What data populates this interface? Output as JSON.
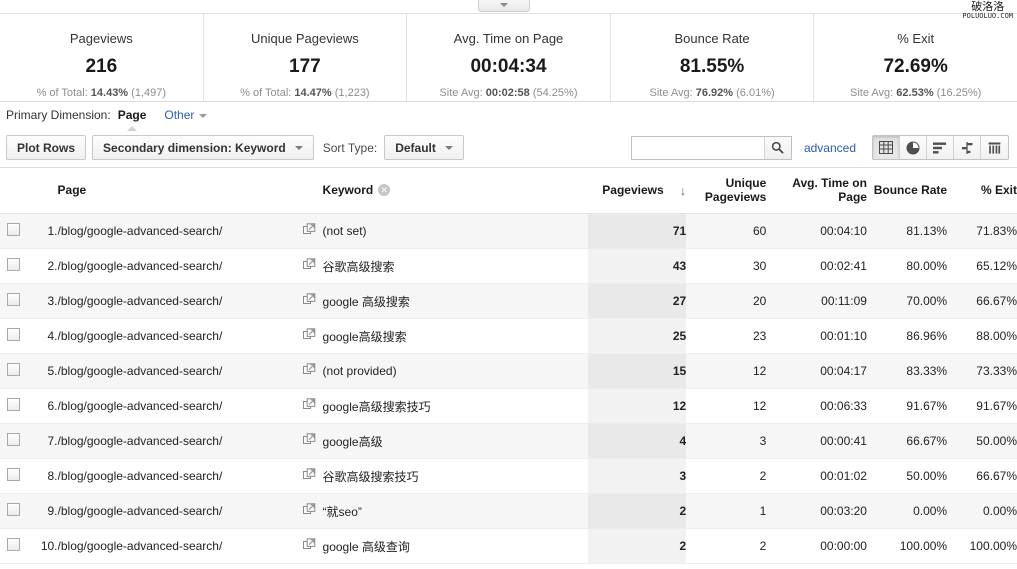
{
  "watermark": {
    "cn": "破洛洛",
    "en": "POLUOLUO.COM"
  },
  "collapse_tab": {
    "icon": "chevron-down-icon"
  },
  "metrics": [
    {
      "label": "Pageviews",
      "value": "216",
      "sub_prefix": "% of Total: ",
      "sub_strong": "14.43%",
      "sub_suffix": " (1,497)"
    },
    {
      "label": "Unique Pageviews",
      "value": "177",
      "sub_prefix": "% of Total: ",
      "sub_strong": "14.47%",
      "sub_suffix": " (1,223)"
    },
    {
      "label": "Avg. Time on Page",
      "value": "00:04:34",
      "sub_prefix": "Site Avg: ",
      "sub_strong": "00:02:58",
      "sub_suffix": " (54.25%)"
    },
    {
      "label": "Bounce Rate",
      "value": "81.55%",
      "sub_prefix": "Site Avg: ",
      "sub_strong": "76.92%",
      "sub_suffix": " (6.01%)"
    },
    {
      "label": "% Exit",
      "value": "72.69%",
      "sub_prefix": "Site Avg: ",
      "sub_strong": "62.53%",
      "sub_suffix": " (16.25%)"
    }
  ],
  "primary_dimension": {
    "label": "Primary Dimension:",
    "active": "Page",
    "other": "Other"
  },
  "controls": {
    "plot_rows": "Plot Rows",
    "secondary_dimension": "Secondary dimension: Keyword",
    "sort_type_label": "Sort Type:",
    "sort_type_value": "Default",
    "search_value": "",
    "search_placeholder": "",
    "advanced": "advanced",
    "views": [
      {
        "name": "table-view-icon",
        "active": true
      },
      {
        "name": "pie-chart-view-icon",
        "active": false
      },
      {
        "name": "performance-view-icon",
        "active": false
      },
      {
        "name": "comparison-view-icon",
        "active": false
      },
      {
        "name": "pivot-view-icon",
        "active": false
      }
    ]
  },
  "table": {
    "headers": {
      "page": "Page",
      "keyword": "Keyword",
      "pageviews": "Pageviews",
      "unique_pageviews": "Unique Pageviews",
      "avg_time": "Avg. Time on Page",
      "bounce_rate": "Bounce Rate",
      "exit": "% Exit",
      "sort_arrow": "↓"
    },
    "rows": [
      {
        "num": "1.",
        "page": "/blog/google-advanced-search/",
        "keyword": "(not set)",
        "pageviews": "71",
        "unique_pageviews": "60",
        "avg_time": "00:04:10",
        "bounce_rate": "81.13%",
        "exit": "71.83%"
      },
      {
        "num": "2.",
        "page": "/blog/google-advanced-search/",
        "keyword": "谷歌高级搜索",
        "pageviews": "43",
        "unique_pageviews": "30",
        "avg_time": "00:02:41",
        "bounce_rate": "80.00%",
        "exit": "65.12%"
      },
      {
        "num": "3.",
        "page": "/blog/google-advanced-search/",
        "keyword": "google 高级搜索",
        "pageviews": "27",
        "unique_pageviews": "20",
        "avg_time": "00:11:09",
        "bounce_rate": "70.00%",
        "exit": "66.67%"
      },
      {
        "num": "4.",
        "page": "/blog/google-advanced-search/",
        "keyword": "google高级搜索",
        "pageviews": "25",
        "unique_pageviews": "23",
        "avg_time": "00:01:10",
        "bounce_rate": "86.96%",
        "exit": "88.00%"
      },
      {
        "num": "5.",
        "page": "/blog/google-advanced-search/",
        "keyword": "(not provided)",
        "pageviews": "15",
        "unique_pageviews": "12",
        "avg_time": "00:04:17",
        "bounce_rate": "83.33%",
        "exit": "73.33%"
      },
      {
        "num": "6.",
        "page": "/blog/google-advanced-search/",
        "keyword": "google高级搜索技巧",
        "pageviews": "12",
        "unique_pageviews": "12",
        "avg_time": "00:06:33",
        "bounce_rate": "91.67%",
        "exit": "91.67%"
      },
      {
        "num": "7.",
        "page": "/blog/google-advanced-search/",
        "keyword": "google高级",
        "pageviews": "4",
        "unique_pageviews": "3",
        "avg_time": "00:00:41",
        "bounce_rate": "66.67%",
        "exit": "50.00%"
      },
      {
        "num": "8.",
        "page": "/blog/google-advanced-search/",
        "keyword": "谷歌高级搜索技巧",
        "pageviews": "3",
        "unique_pageviews": "2",
        "avg_time": "00:01:02",
        "bounce_rate": "50.00%",
        "exit": "66.67%"
      },
      {
        "num": "9.",
        "page": "/blog/google-advanced-search/",
        "keyword": "“就seo”",
        "pageviews": "2",
        "unique_pageviews": "1",
        "avg_time": "00:03:20",
        "bounce_rate": "0.00%",
        "exit": "0.00%"
      },
      {
        "num": "10.",
        "page": "/blog/google-advanced-search/",
        "keyword": "google 高级查询",
        "pageviews": "2",
        "unique_pageviews": "2",
        "avg_time": "00:00:00",
        "bounce_rate": "100.00%",
        "exit": "100.00%"
      }
    ]
  }
}
